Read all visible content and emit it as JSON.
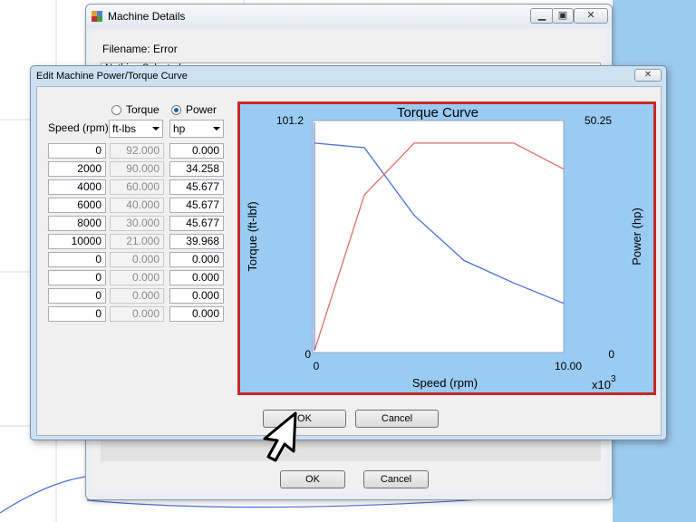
{
  "parent_window": {
    "title": "Machine Details",
    "filename_label": "Filename: Error",
    "field_partial": "Nothing Selected",
    "ok_label": "OK",
    "cancel_label": "Cancel",
    "minimize_glyph": "▁",
    "restore_glyph": "▣",
    "close_glyph": "✕"
  },
  "dialog": {
    "title": "Edit Machine Power/Torque Curve",
    "close_glyph": "✕",
    "torque_radio_label": "Torque",
    "power_radio_label": "Power",
    "selected_radio": "Power",
    "speed_header": "Speed (rpm)",
    "torque_unit": "ft-lbs",
    "power_unit": "hp",
    "ok_label": "OK",
    "cancel_label": "Cancel"
  },
  "table": {
    "rows": [
      {
        "speed": "0",
        "torque": "92.000",
        "power": "0.000"
      },
      {
        "speed": "2000",
        "torque": "90.000",
        "power": "34.258"
      },
      {
        "speed": "4000",
        "torque": "60.000",
        "power": "45.677"
      },
      {
        "speed": "6000",
        "torque": "40.000",
        "power": "45.677"
      },
      {
        "speed": "8000",
        "torque": "30.000",
        "power": "45.677"
      },
      {
        "speed": "10000",
        "torque": "21.000",
        "power": "39.968"
      },
      {
        "speed": "0",
        "torque": "0.000",
        "power": "0.000"
      },
      {
        "speed": "0",
        "torque": "0.000",
        "power": "0.000"
      },
      {
        "speed": "0",
        "torque": "0.000",
        "power": "0.000"
      },
      {
        "speed": "0",
        "torque": "0.000",
        "power": "0.000"
      }
    ]
  },
  "chart_data": {
    "type": "line",
    "title": "Torque Curve",
    "xlabel": "Speed (rpm)",
    "ylabel": "Torque (ft-lbf)",
    "y2label": "Power (hp)",
    "x_multiplier_label": "x10",
    "x_multiplier_exp": "3",
    "x_tick_labels": {
      "min": "0",
      "max": "10.00"
    },
    "y_tick_labels": {
      "min": "0",
      "max": "101.2"
    },
    "y2_tick_labels": {
      "min": "0",
      "max": "50.25"
    },
    "xlim": [
      0,
      10
    ],
    "ylim": [
      0,
      101.2
    ],
    "y2lim": [
      0,
      50.25
    ],
    "grid": false,
    "series": [
      {
        "name": "Torque",
        "axis": "left",
        "color": "#4a6fd1",
        "x": [
          0,
          2,
          4,
          6,
          8,
          10
        ],
        "values": [
          92,
          90,
          60,
          40,
          30,
          21
        ]
      },
      {
        "name": "Power",
        "axis": "right",
        "color": "#d9706a",
        "x": [
          0,
          2,
          4,
          6,
          8,
          10
        ],
        "values": [
          0,
          34.258,
          45.677,
          45.677,
          45.677,
          39.968
        ]
      }
    ]
  },
  "colors": {
    "chart_background": "#99cbf3",
    "chart_border": "#c62828",
    "plot_area": "#ffffff"
  },
  "icons": {
    "app": "machine-app-icon",
    "cursor": "mouse-pointer-icon"
  }
}
